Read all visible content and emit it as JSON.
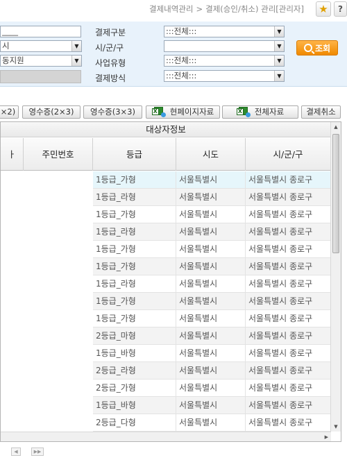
{
  "header": {
    "breadcrumb": [
      "결제내역관리",
      "결제(승인/취소) 관리[관리자]"
    ],
    "breadcrumb_sep": ">",
    "help_label": "?"
  },
  "search": {
    "name_input_value": "____",
    "city_select_value": "시",
    "center_select_value": "동지원",
    "payment_category_label": "결제구분",
    "payment_category_value": ":::전체:::",
    "district_label": "시/군/구",
    "district_value": "",
    "business_type_label": "사업유형",
    "business_type_value": ":::전체:::",
    "payment_method_label": "결제방식",
    "payment_method_value": ":::전체:::",
    "search_button_label": "조회"
  },
  "toolbar": {
    "receipt_2x2_label": "×2)",
    "receipt_2x3_label": "영수증(2×3)",
    "receipt_3x3_label": "영수증(3×3)",
    "current_page_export_label": "현페이지자료",
    "all_export_label": "전체자료",
    "cancel_payment_label": "결제취소"
  },
  "grid": {
    "group_header": "대상자정보",
    "columns": [
      "ㅏ",
      "주민번호",
      "등급",
      "시도",
      "시/군/구"
    ],
    "rows": [
      {
        "grade": "1등급_가형",
        "sido": "서울특별시",
        "sigungu": "서울특별시 종로구"
      },
      {
        "grade": "1등급_라형",
        "sido": "서울특별시",
        "sigungu": "서울특별시 종로구"
      },
      {
        "grade": "1등급_가형",
        "sido": "서울특별시",
        "sigungu": "서울특별시 종로구"
      },
      {
        "grade": "1등급_라형",
        "sido": "서울특별시",
        "sigungu": "서울특별시 종로구"
      },
      {
        "grade": "1등급_가형",
        "sido": "서울특별시",
        "sigungu": "서울특별시 종로구"
      },
      {
        "grade": "1등급_가형",
        "sido": "서울특별시",
        "sigungu": "서울특별시 종로구"
      },
      {
        "grade": "1등급_라형",
        "sido": "서울특별시",
        "sigungu": "서울특별시 종로구"
      },
      {
        "grade": "1등급_가형",
        "sido": "서울특별시",
        "sigungu": "서울특별시 종로구"
      },
      {
        "grade": "1등급_가형",
        "sido": "서울특별시",
        "sigungu": "서울특별시 종로구"
      },
      {
        "grade": "2등급_마형",
        "sido": "서울특별시",
        "sigungu": "서울특별시 종로구"
      },
      {
        "grade": "1등급_바형",
        "sido": "서울특별시",
        "sigungu": "서울특별시 종로구"
      },
      {
        "grade": "2등급_라형",
        "sido": "서울특별시",
        "sigungu": "서울특별시 종로구"
      },
      {
        "grade": "2등급_가형",
        "sido": "서울특별시",
        "sigungu": "서울특별시 종로구"
      },
      {
        "grade": "1등급_바형",
        "sido": "서울특별시",
        "sigungu": "서울특별시 종로구"
      },
      {
        "grade": "2등급_다형",
        "sido": "서울특별시",
        "sigungu": "서울특별시 종로구"
      }
    ],
    "selected_row": 0
  },
  "colors": {
    "search_panel_bg": "#e8f2fb",
    "search_button": "#f08a00",
    "selected_row_bg": "#e6f6fb",
    "alt_row_bg": "#f3f3f3"
  },
  "icons": [
    "star-icon",
    "help-icon",
    "search-icon",
    "excel-icon",
    "scroll-up-icon",
    "scroll-down-icon"
  ]
}
